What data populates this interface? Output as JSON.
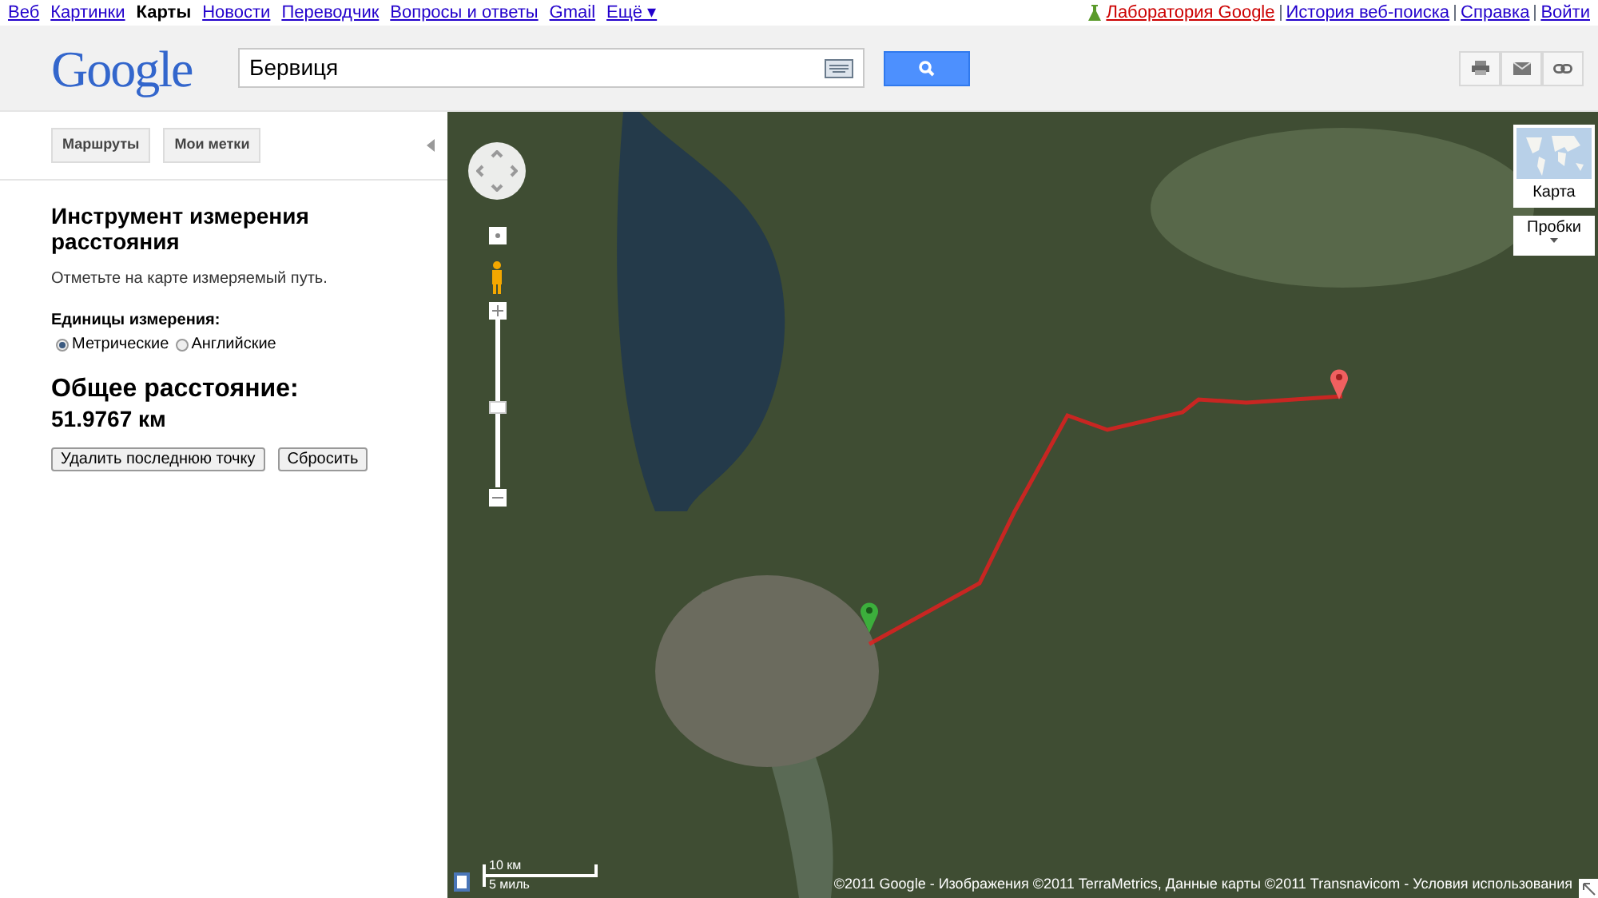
{
  "top_nav": {
    "items": [
      {
        "label": "Веб",
        "selected": false
      },
      {
        "label": "Картинки",
        "selected": false
      },
      {
        "label": "Карты",
        "selected": true
      },
      {
        "label": "Новости",
        "selected": false
      },
      {
        "label": "Переводчик",
        "selected": false
      },
      {
        "label": "Вопросы и ответы",
        "selected": false
      },
      {
        "label": "Gmail",
        "selected": false
      },
      {
        "label": "Ещё ▾",
        "selected": false
      }
    ],
    "right_links": [
      "Лаборатория Google",
      "История веб-поиска",
      "Справка",
      "Войти"
    ]
  },
  "header": {
    "logo": "Google",
    "search": {
      "value": "Бервиця"
    }
  },
  "sidebar": {
    "buttons": [
      "Маршруты",
      "Мои метки"
    ],
    "title": "Инструмент измерения расстояния",
    "hint": "Отметьте на карте измеряемый путь.",
    "units_label": "Единицы измерения:",
    "units": [
      {
        "label": "Метрические",
        "selected": true
      },
      {
        "label": "Английские",
        "selected": false
      }
    ],
    "total_label": "Общее расстояние:",
    "total_value": "51.9767 км",
    "actions": [
      "Удалить последнюю точку",
      "Сбросить"
    ]
  },
  "map": {
    "zoom": {
      "level": 0.47
    },
    "map_type": "Карта",
    "traffic": "Пробки",
    "scale": [
      "10 км",
      "5 миль"
    ],
    "attribution": "©2011 Google - Изображения ©2011 TerraMetrics, Данные карты ©2011 Transnavicom - Условия использования"
  }
}
